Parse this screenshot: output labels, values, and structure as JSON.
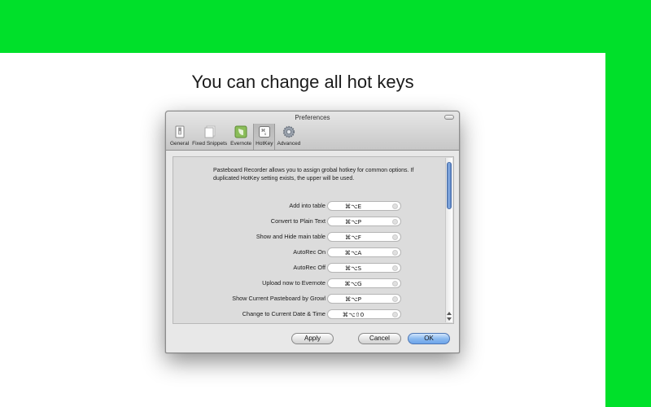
{
  "headline": "You can change all hot keys",
  "window": {
    "title": "Preferences",
    "toolbar": [
      {
        "label": "General",
        "icon": "switch-icon"
      },
      {
        "label": "Fixed Snippets",
        "icon": "snippets-icon"
      },
      {
        "label": "Evernote",
        "icon": "evernote-icon"
      },
      {
        "label": "HotKey",
        "icon": "hotkey-icon",
        "selected": true
      },
      {
        "label": "Advanced",
        "icon": "gear-icon"
      }
    ],
    "description": "Pasteboard Recorder allows you to assign grobal hotkey for common options. If duplicated HotKey setting exists, the upper will be used.",
    "hotkeys": [
      {
        "label": "Add into table",
        "value": "⌘⌥E"
      },
      {
        "label": "Convert to Plain Text",
        "value": "⌘⌥P"
      },
      {
        "label": "Show and Hide main table",
        "value": "⌘⌥F"
      },
      {
        "label": "AutoRec On",
        "value": "⌘⌥A"
      },
      {
        "label": "AutoRec Off",
        "value": "⌘⌥S"
      },
      {
        "label": "Upload now to Evernote",
        "value": "⌘⌥G"
      },
      {
        "label": "Show Current Pasteboard by Growl",
        "value": "⌘⌥P"
      },
      {
        "label": "Change to Current Date & Time",
        "value": "⌘⌥⇧0"
      }
    ],
    "buttons": {
      "apply": "Apply",
      "cancel": "Cancel",
      "ok": "OK"
    }
  },
  "colors": {
    "accent_green": "#00e02a",
    "ok_blue": "#8bbaf0"
  }
}
